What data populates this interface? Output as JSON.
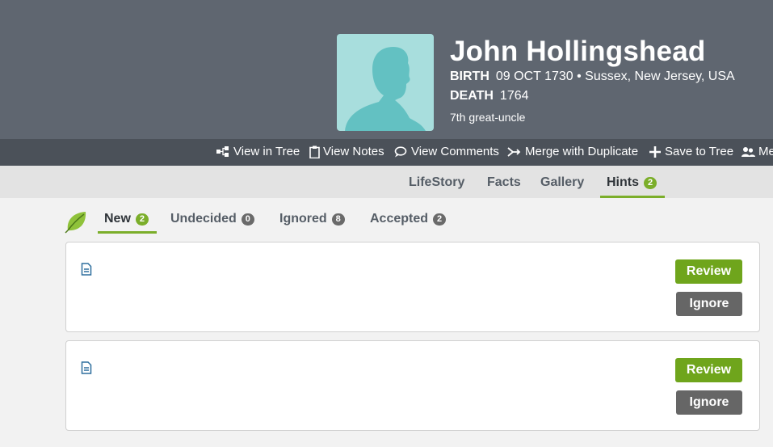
{
  "person": {
    "name": "John Hollingshead",
    "birth_label": "BIRTH",
    "birth_value": "09 OCT 1730 • Sussex, New Jersey, USA",
    "death_label": "DEATH",
    "death_value": "1764",
    "relationship": "7th great-uncle"
  },
  "actions": [
    {
      "label": "View in Tree",
      "icon": "tree-icon"
    },
    {
      "label": "View Notes",
      "icon": "clipboard-icon"
    },
    {
      "label": "View Comments",
      "icon": "comments-icon"
    },
    {
      "label": "Merge with Duplicate",
      "icon": "merge-icon"
    },
    {
      "label": "Save to Tree",
      "icon": "plus-icon"
    },
    {
      "label": "Me",
      "icon": "people-icon"
    }
  ],
  "tabs": [
    {
      "label": "LifeStory"
    },
    {
      "label": "Facts"
    },
    {
      "label": "Gallery"
    },
    {
      "label": "Hints",
      "count": "2",
      "active": true
    }
  ],
  "hint_tabs": [
    {
      "label": "New",
      "count": "2",
      "active": true
    },
    {
      "label": "Undecided",
      "count": "0"
    },
    {
      "label": "Ignored",
      "count": "8"
    },
    {
      "label": "Accepted",
      "count": "2"
    }
  ],
  "hints": [
    {
      "review_label": "Review",
      "ignore_label": "Ignore"
    },
    {
      "review_label": "Review",
      "ignore_label": "Ignore"
    }
  ],
  "colors": {
    "header_bg": "#5f6670",
    "action_bar_bg": "#4b5159",
    "accent_green": "#7bae2a",
    "ignore_gray": "#666666"
  }
}
